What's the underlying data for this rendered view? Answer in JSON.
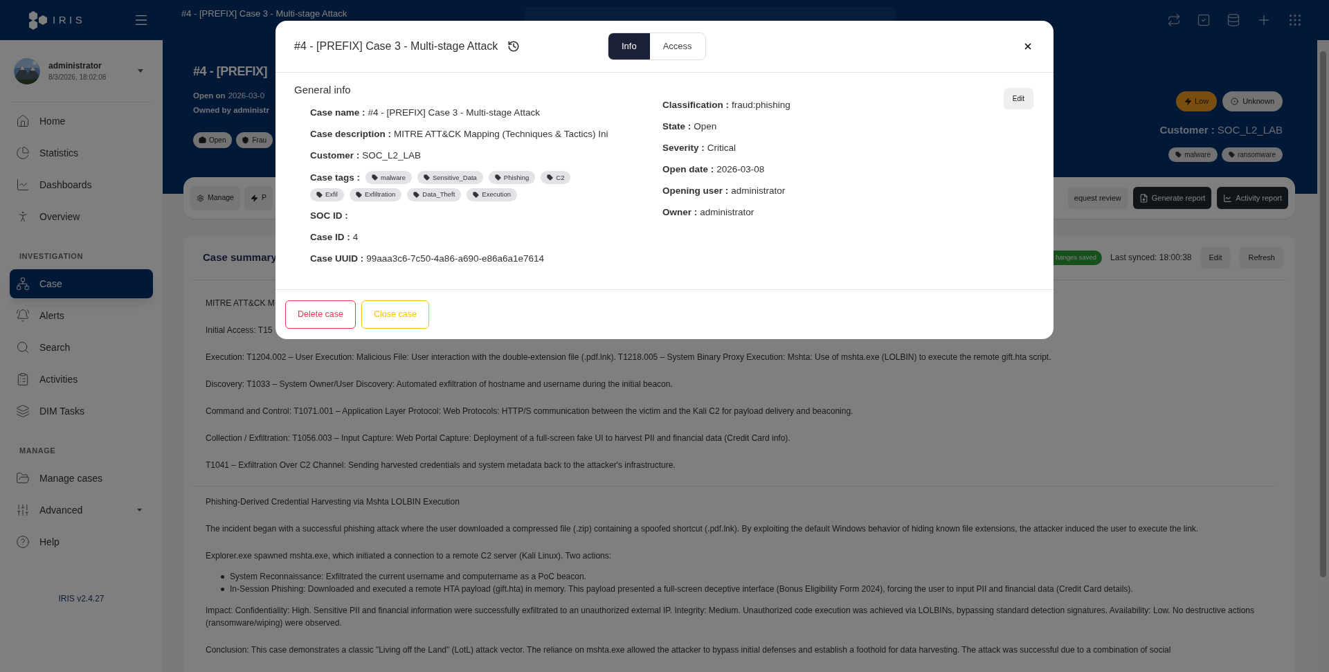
{
  "top_bar": {
    "logo": "IRIS",
    "breadcrumb": "#4 - [PREFIX] Case 3 - Multi-stage Attack"
  },
  "sidebar": {
    "user": {
      "name": "administrator",
      "time": "8/3/2026, 18:02:08"
    },
    "items": [
      {
        "kind": "item",
        "label": "Home",
        "selected": false,
        "submenu": false
      },
      {
        "kind": "item",
        "label": "Statistics",
        "selected": false,
        "submenu": false
      },
      {
        "kind": "item",
        "label": "Dashboards",
        "selected": false,
        "submenu": false
      },
      {
        "kind": "item",
        "label": "Overview",
        "selected": false,
        "submenu": false
      },
      {
        "kind": "heading",
        "label": "INVESTIGATION"
      },
      {
        "kind": "item",
        "label": "Case",
        "selected": true,
        "submenu": false
      },
      {
        "kind": "item",
        "label": "Alerts",
        "selected": false,
        "submenu": false
      },
      {
        "kind": "item",
        "label": "Search",
        "selected": false,
        "submenu": false
      },
      {
        "kind": "item",
        "label": "Activities",
        "selected": false,
        "submenu": false
      },
      {
        "kind": "item",
        "label": "DIM Tasks",
        "selected": false,
        "submenu": false
      },
      {
        "kind": "heading",
        "label": "MANAGE"
      },
      {
        "kind": "item",
        "label": "Manage cases",
        "selected": false,
        "submenu": false
      },
      {
        "kind": "item",
        "label": "Advanced",
        "selected": false,
        "submenu": true
      },
      {
        "kind": "item",
        "label": "Help",
        "selected": false,
        "submenu": false
      }
    ],
    "version": "IRIS v2.4.27"
  },
  "case_header": {
    "title": "#4 - [PREFIX]",
    "open_on": {
      "label": "Open on",
      "value": "2026-03-0"
    },
    "owned_by": "Owned by administr",
    "badges": [
      "Open",
      "Frau"
    ],
    "severity": "Low",
    "status": "Unknown",
    "customer": {
      "label": "Customer :",
      "value": "SOC_L2_LAB"
    },
    "tags": [
      "malware",
      "ransomware"
    ]
  },
  "action_bar": {
    "left": [
      {
        "label": "Manage"
      },
      {
        "label": "P"
      }
    ],
    "right": [
      {
        "label": "equest review",
        "kind": "light"
      },
      {
        "label": "Generate report",
        "kind": "dark"
      },
      {
        "label": "Activity report",
        "kind": "dark"
      }
    ]
  },
  "summary": {
    "title": "Case summary",
    "save_status": "hanges saved",
    "last_synced": "Last synced: 18:00:38",
    "buttons": [
      "Edit",
      "Refresh"
    ],
    "blocks": [
      {
        "kind": "p",
        "text": "MITRE ATT&CK M"
      },
      {
        "kind": "p",
        "text": "Initial Access: T15"
      },
      {
        "kind": "p",
        "text": "Execution: T1204.002 – User Execution: Malicious File: User interaction with the double-extension file (.pdf.lnk). T1218.005 – System Binary Proxy Execution: Mshta: Use of mshta.exe (LOLBIN) to execute the remote gift.hta script."
      },
      {
        "kind": "p",
        "text": "Discovery: T1033 – System Owner/User Discovery: Automated exfiltration of hostname and username during the initial beacon."
      },
      {
        "kind": "p",
        "text": "Command and Control: T1071.001 – Application Layer Protocol: Web Protocols: HTTP/S communication between the victim and the Kali C2 for payload delivery and beaconing."
      },
      {
        "kind": "p",
        "text": "Collection / Exfiltration: T1056.003 – Input Capture: Web Portal Capture: Deployment of a full-screen fake UI to harvest PII and financial data (Credit Card info)."
      },
      {
        "kind": "p",
        "text": "T1041 – Exfiltration Over C2 Channel: Sending harvested credentials and system metadata back to the attacker's infrastructure."
      },
      {
        "kind": "rule"
      },
      {
        "kind": "p",
        "text": "Phishing-Derived Credential Harvesting via Mshta LOLBIN Execution"
      },
      {
        "kind": "p",
        "text": "The incident began with a successful phishing attack where the user downloaded a compressed file (.zip) containing a spoofed shortcut (.pdf.lnk). By exploiting the default Windows behavior of hiding known file extensions, the attacker induced the user to execute the link."
      },
      {
        "kind": "p",
        "text": "Explorer.exe spawned mshta.exe, which initiated a connection to a remote C2 server (Kali Linux). Two actions:"
      },
      {
        "kind": "list",
        "items": [
          "System Reconnaissance: Exfiltrated the current username and computername as a PoC beacon.",
          "In-Session Phishing: Downloaded and executed a remote HTA payload (gift.hta) in memory. This payload presented a full-screen deceptive interface (Bonus Eligibility Form 2024), forcing the user to input PII and financial data (Credit Card details)."
        ]
      },
      {
        "kind": "p",
        "text": "Impact: Confidentiality: High. Sensitive PII and financial information were successfully exfiltrated to an unauthorized external IP. Integrity: Medium. Unauthorized code execution was achieved via LOLBINs, bypassing standard detection signatures. Availability: Low. No destructive actions (ransomware/wiping) were observed."
      },
      {
        "kind": "p",
        "text": "Conclusion: This case demonstrates a classic \"Living off the Land\" (LotL) attack vector. The reliance on mshta.exe allowed the attacker to bypass initial defenses and establish a foothold for data harvesting. The attack was successful due to a combination of social"
      }
    ]
  },
  "modal": {
    "title": "#4 - [PREFIX] Case 3 - Multi-stage Attack",
    "tabs": [
      {
        "label": "Info",
        "selected": true
      },
      {
        "label": "Access",
        "selected": false
      }
    ],
    "section": "General info",
    "edit": "Edit",
    "left_fields": [
      {
        "label": "Case name :",
        "value": "#4 - [PREFIX] Case 3 - Multi-stage Attack"
      },
      {
        "label": "Case description :",
        "value": "MITRE ATT&CK Mapping (Techniques & Tactics) Ini"
      },
      {
        "label": "Customer :",
        "value": "SOC_L2_LAB"
      },
      {
        "label": "Case tags :",
        "tags": [
          "malware",
          "Sensitive_Data",
          "Phishing",
          "C2",
          "Exfil",
          "Exfiltration",
          "Data_Theft",
          "Execution"
        ]
      },
      {
        "label": "SOC ID :"
      },
      {
        "label": "Case ID :",
        "value": "4"
      },
      {
        "label": "Case UUID :",
        "value": "99aaa3c6-7c50-4a86-a690-e86a6a1e7614"
      }
    ],
    "right_fields": [
      {
        "label": "Classification :",
        "value": "fraud:phishing"
      },
      {
        "label": "State :",
        "value": "Open"
      },
      {
        "label": "Severity :",
        "value": "Critical"
      },
      {
        "label": "Open date :",
        "value": "2026-03-08"
      },
      {
        "label": "Opening user :",
        "value": "administrator"
      },
      {
        "label": "Owner :",
        "value": "administrator"
      }
    ],
    "buttons": [
      {
        "label": "Delete case",
        "kind": "danger"
      },
      {
        "label": "Close case",
        "kind": "warning"
      }
    ]
  }
}
